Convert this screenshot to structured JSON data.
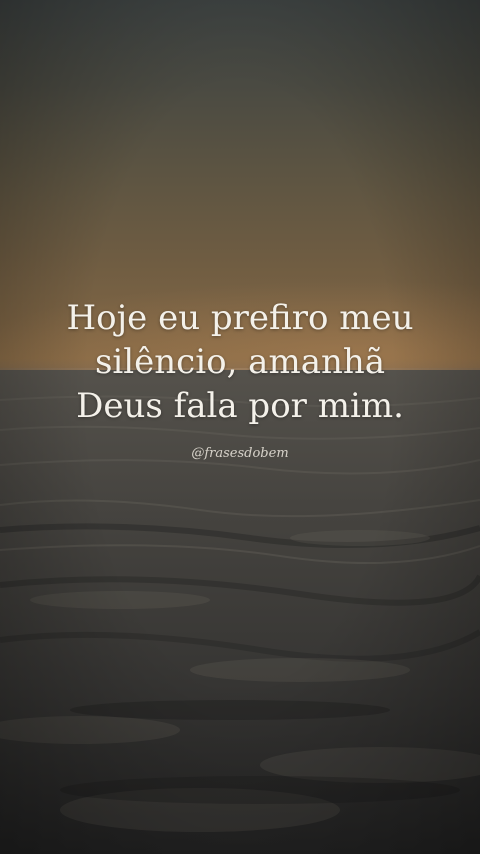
{
  "quote": {
    "lines": [
      "Hoje eu prefiro meu",
      "silêncio, amanhã",
      "Deus fala por mim."
    ]
  },
  "handle": "@frasesdobem",
  "colors": {
    "text": "#f4f1ea",
    "sky_top": "#3f4443",
    "sky_glow": "#876a46",
    "sea_dark": "#1f1f1f"
  }
}
